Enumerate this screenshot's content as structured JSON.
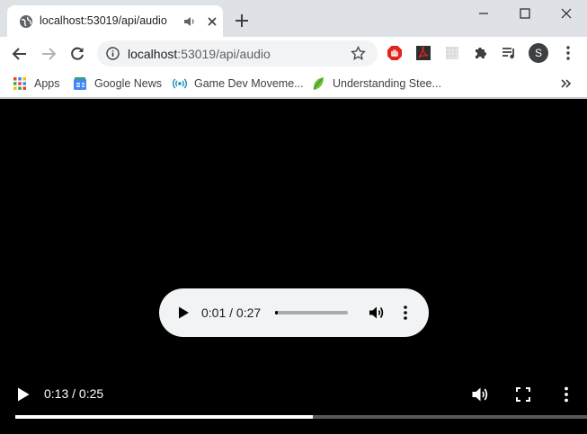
{
  "tab": {
    "title": "localhost:53019/api/audio",
    "favicon": "globe-icon",
    "audio_indicator": "speaker-icon"
  },
  "window_controls": [
    "minimize",
    "maximize",
    "close"
  ],
  "omnibox": {
    "host": "localhost",
    "rest": ":53019/api/audio"
  },
  "profile": {
    "initial": "S"
  },
  "bookmarks": [
    {
      "label": "Apps",
      "icon": "apps-grid-icon"
    },
    {
      "label": "Google News",
      "icon": "google-news-icon"
    },
    {
      "label": "Game Dev Moveme...",
      "icon": "broadcast-icon"
    },
    {
      "label": "Understanding Stee...",
      "icon": "leaf-icon"
    }
  ],
  "audio_player": {
    "time": "0:01 / 0:27",
    "progress": 0.037
  },
  "video_player": {
    "time": "0:13 / 0:25",
    "progress": 0.52
  },
  "colors": {
    "chrome_bg": "#dee1e6",
    "omnibox_bg": "#f1f3f4",
    "page_bg": "#000000",
    "audio_panel_bg": "#f1f3f4"
  }
}
